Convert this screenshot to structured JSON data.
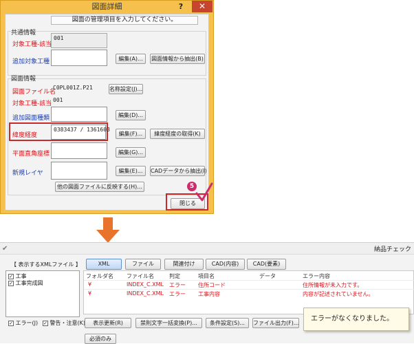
{
  "dialog": {
    "title": "図面詳細",
    "help": "?",
    "close": "✕",
    "banner": "図面の管理項目を入力してください。",
    "common_group": {
      "title": "共通情報",
      "kind_label": "対象工種-該当",
      "kind_value": "001",
      "add_label": "追加対象工種",
      "edit_button": "編集(A)...",
      "extract_button": "図面情報から抽出(B)"
    },
    "drawing_group": {
      "title": "図面情報",
      "file_label": "図面ファイル名",
      "file_value": "C0PL001Z.P21",
      "name_button": "名称設定(J)...",
      "kind_label": "対象工種-該当",
      "kind_value": "001",
      "type_label": "追加図面種類",
      "type_button": "編集(D)...",
      "latlon_label": "緯度経度",
      "latlon_value": "0383437 / 1361603",
      "latlon_edit_button": "編集(F)...",
      "latlon_get_button": "緯度経度の取得(K)",
      "plane_label": "平面直角座標",
      "plane_button": "編集(G)...",
      "layer_label": "新規レイヤ",
      "layer_button": "編集(E)...",
      "cad_extract_button": "CADデータから抽出(I)",
      "reflect_button": "他の図面ファイルに反映する(H)..."
    },
    "close_button": "閉じる",
    "step_badge": "5"
  },
  "window": {
    "title": "納品チェック",
    "left_header": "【 表示するXMLファイル 】",
    "tabs": [
      "XML",
      "ファイル",
      "関連付け",
      "CAD(内容)",
      "CAD(要素)"
    ],
    "tree": [
      {
        "label": "工事",
        "checked": true
      },
      {
        "label": "工事完成図",
        "checked": true
      }
    ],
    "columns": [
      "フォルダ名",
      "ファイル名",
      "判定",
      "項目名",
      "データ",
      "エラー内容"
    ],
    "rows": [
      {
        "folder": "¥",
        "file": "INDEX_C.XML",
        "judge": "エラー",
        "item": "住所コード",
        "data": "",
        "error": "住所情報が未入力です。"
      },
      {
        "folder": "¥",
        "file": "INDEX_C.XML",
        "judge": "エラー",
        "item": "工事内容",
        "data": "",
        "error": "内容が記述されていません。"
      }
    ],
    "filter_error": "エラー(J)",
    "filter_warning": "警告・注意(K)",
    "refresh_button": "表示更新(R)",
    "convert_button": "禁則文字一括変換(P)...",
    "condition_button": "条件設定(S)...",
    "output_button": "ファイル出力(F)...",
    "required_button": "必須のみ",
    "callout": "エラーがなくなりました。"
  },
  "colors": {
    "dialog_frame": "#f5c14c",
    "highlight": "#c62a2a",
    "arrow": "#e8742c",
    "error_text": "#d8141b",
    "badge": "#cc2c6b"
  }
}
